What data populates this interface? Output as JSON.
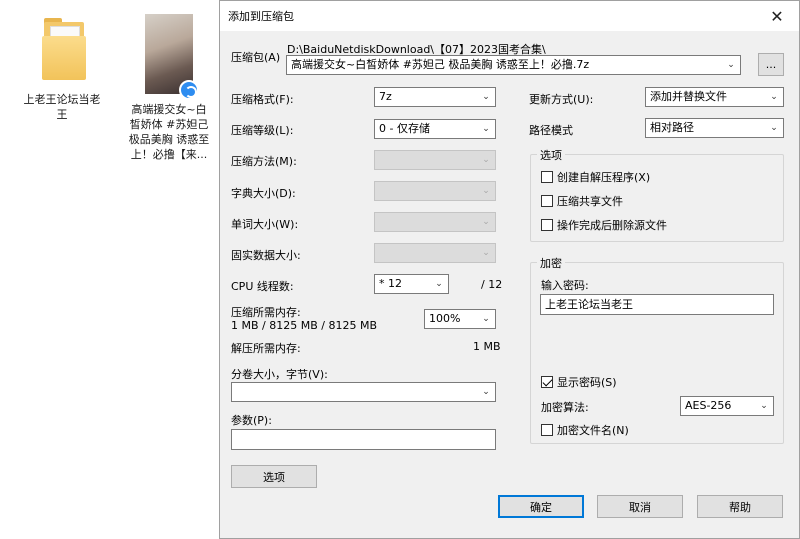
{
  "desktop": {
    "folder_label": "上老王论坛当老王",
    "video_label": "高端援交女~白皙娇体 #苏妲己 极品美胸 诱惑至上！必撸【来..."
  },
  "dialog": {
    "title": "添加到压缩包",
    "close_glyph": "✕",
    "archive_label": "压缩包(A)",
    "archive_path": "D:\\BaiduNetdiskDownload\\【07】2023国考合集\\",
    "archive_name": "高端援交女~白皙娇体 #苏妲己 极品美胸 诱惑至上！必撸.7z",
    "browse_label": "...",
    "format_label": "压缩格式(F):",
    "format_value": "7z",
    "level_label": "压缩等级(L):",
    "level_value": "0 - 仅存储",
    "method_label": "压缩方法(M):",
    "dict_label": "字典大小(D):",
    "word_label": "单词大小(W):",
    "solid_label": "固实数据大小:",
    "cpu_label": "CPU 线程数:",
    "cpu_value": "* 12",
    "cpu_total": "/ 12",
    "mem_comp_label": "压缩所需内存:",
    "mem_comp_value": "1 MB / 8125 MB / 8125 MB",
    "mem_percent": "100%",
    "mem_decomp_label": "解压所需内存:",
    "mem_decomp_value": "1 MB",
    "split_label": "分卷大小，字节(V):",
    "split_value": "",
    "params_label": "参数(P):",
    "params_value": "",
    "options_button": "选项",
    "update_label": "更新方式(U):",
    "update_value": "添加并替换文件",
    "path_mode_label": "路径模式",
    "path_mode_value": "相对路径",
    "options_group": "选项",
    "opt_sfx": "创建自解压程序(X)",
    "opt_shared": "压缩共享文件",
    "opt_delete": "操作完成后删除源文件",
    "encrypt_group": "加密",
    "password_label": "输入密码:",
    "password_value": "上老王论坛当老王",
    "show_password": "显示密码(S)",
    "encrypt_method_label": "加密算法:",
    "encrypt_method_value": "AES-256",
    "encrypt_names": "加密文件名(N)",
    "ok_button": "确定",
    "cancel_button": "取消",
    "help_button": "帮助"
  }
}
